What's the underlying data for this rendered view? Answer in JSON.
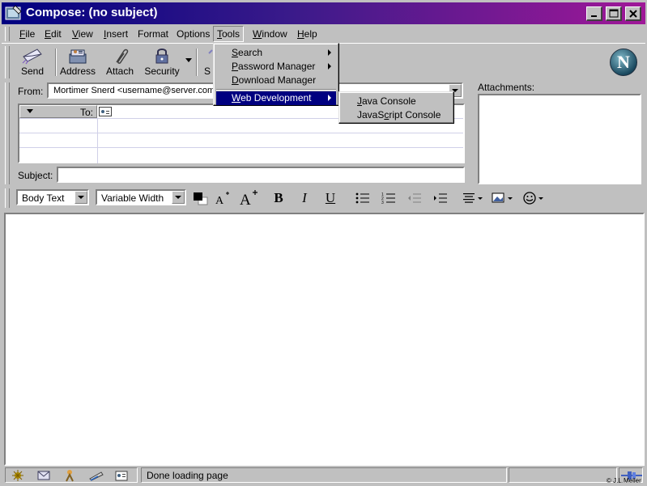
{
  "window": {
    "title": "Compose: (no subject)"
  },
  "menubar": {
    "items": [
      {
        "label": "File",
        "accel": "F",
        "rest": "ile"
      },
      {
        "label": "Edit",
        "accel": "E",
        "rest": "dit"
      },
      {
        "label": "View",
        "accel": "V",
        "rest": "iew"
      },
      {
        "label": "Insert",
        "accel": "I",
        "rest": "nsert"
      },
      {
        "label": "Format",
        "accel": "",
        "rest": "Format"
      },
      {
        "label": "Options",
        "accel": "",
        "rest": "Options"
      },
      {
        "label": "Tools",
        "accel": "T",
        "rest": "ools"
      },
      {
        "label": "Window",
        "accel": "W",
        "rest": "indow"
      },
      {
        "label": "Help",
        "accel": "H",
        "rest": "elp"
      }
    ]
  },
  "toolbar": {
    "send": "Send",
    "address": "Address",
    "attach": "Attach",
    "security": "Security",
    "partial": "S"
  },
  "compose": {
    "from_label": "From:",
    "from_value": "Mortimer Snerd <username@server.com>",
    "to_label": "To:",
    "subject_label": "Subject:",
    "subject_value": "",
    "attachments_label": "Attachments:"
  },
  "format": {
    "paragraph_style": "Body Text",
    "font": "Variable Width",
    "bold": "B",
    "italic": "I",
    "underline": "U"
  },
  "status": {
    "text": "Done loading page",
    "copyright": "© J.L.Meller"
  },
  "tools_menu": {
    "items": [
      {
        "accel": "S",
        "rest": "earch",
        "label": "Search",
        "submenu": true
      },
      {
        "accel": "P",
        "rest": "assword Manager",
        "label": "Password Manager",
        "submenu": true
      },
      {
        "accel": "D",
        "rest": "ownload Manager",
        "label": "Download Manager",
        "submenu": false
      },
      {
        "accel": "W",
        "rest": "eb Development",
        "label": "Web Development",
        "submenu": true,
        "highlighted": true
      }
    ]
  },
  "webdev_menu": {
    "items": [
      {
        "pre": "",
        "accel": "J",
        "rest": "ava Console",
        "label": "Java Console"
      },
      {
        "pre": "JavaS",
        "accel": "c",
        "rest": "ript Console",
        "label": "JavaScript Console"
      }
    ]
  },
  "colors": {
    "title_start": "#000080",
    "title_end": "#a01898",
    "highlight": "#000080",
    "chrome": "#c0c0c0"
  }
}
